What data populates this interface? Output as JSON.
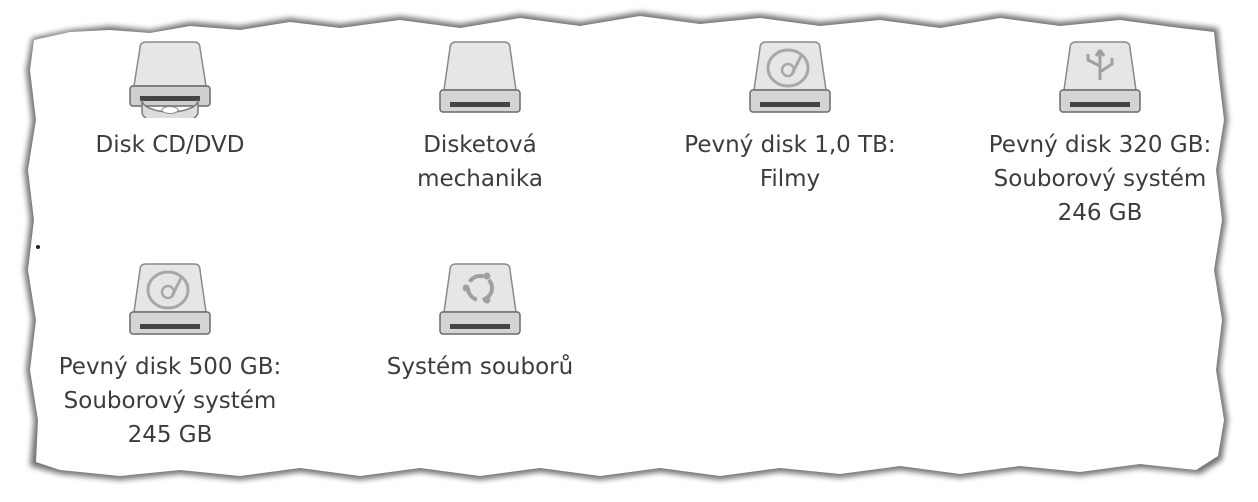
{
  "drives": [
    {
      "label": "Disk CD/DVD",
      "icon": "optical-drive-icon"
    },
    {
      "label": "Disketová\nmechanika",
      "icon": "floppy-drive-icon"
    },
    {
      "label": "Pevný disk 1,0 TB:\nFilmy",
      "icon": "hard-disk-icon"
    },
    {
      "label": "Pevný disk 320 GB:\nSouborový systém\n246 GB",
      "icon": "usb-drive-icon"
    },
    {
      "label": "Pevný disk 500 GB:\nSouborový systém\n245 GB",
      "icon": "hard-disk-icon"
    },
    {
      "label": "Systém souborů",
      "icon": "ubuntu-filesystem-icon"
    }
  ]
}
